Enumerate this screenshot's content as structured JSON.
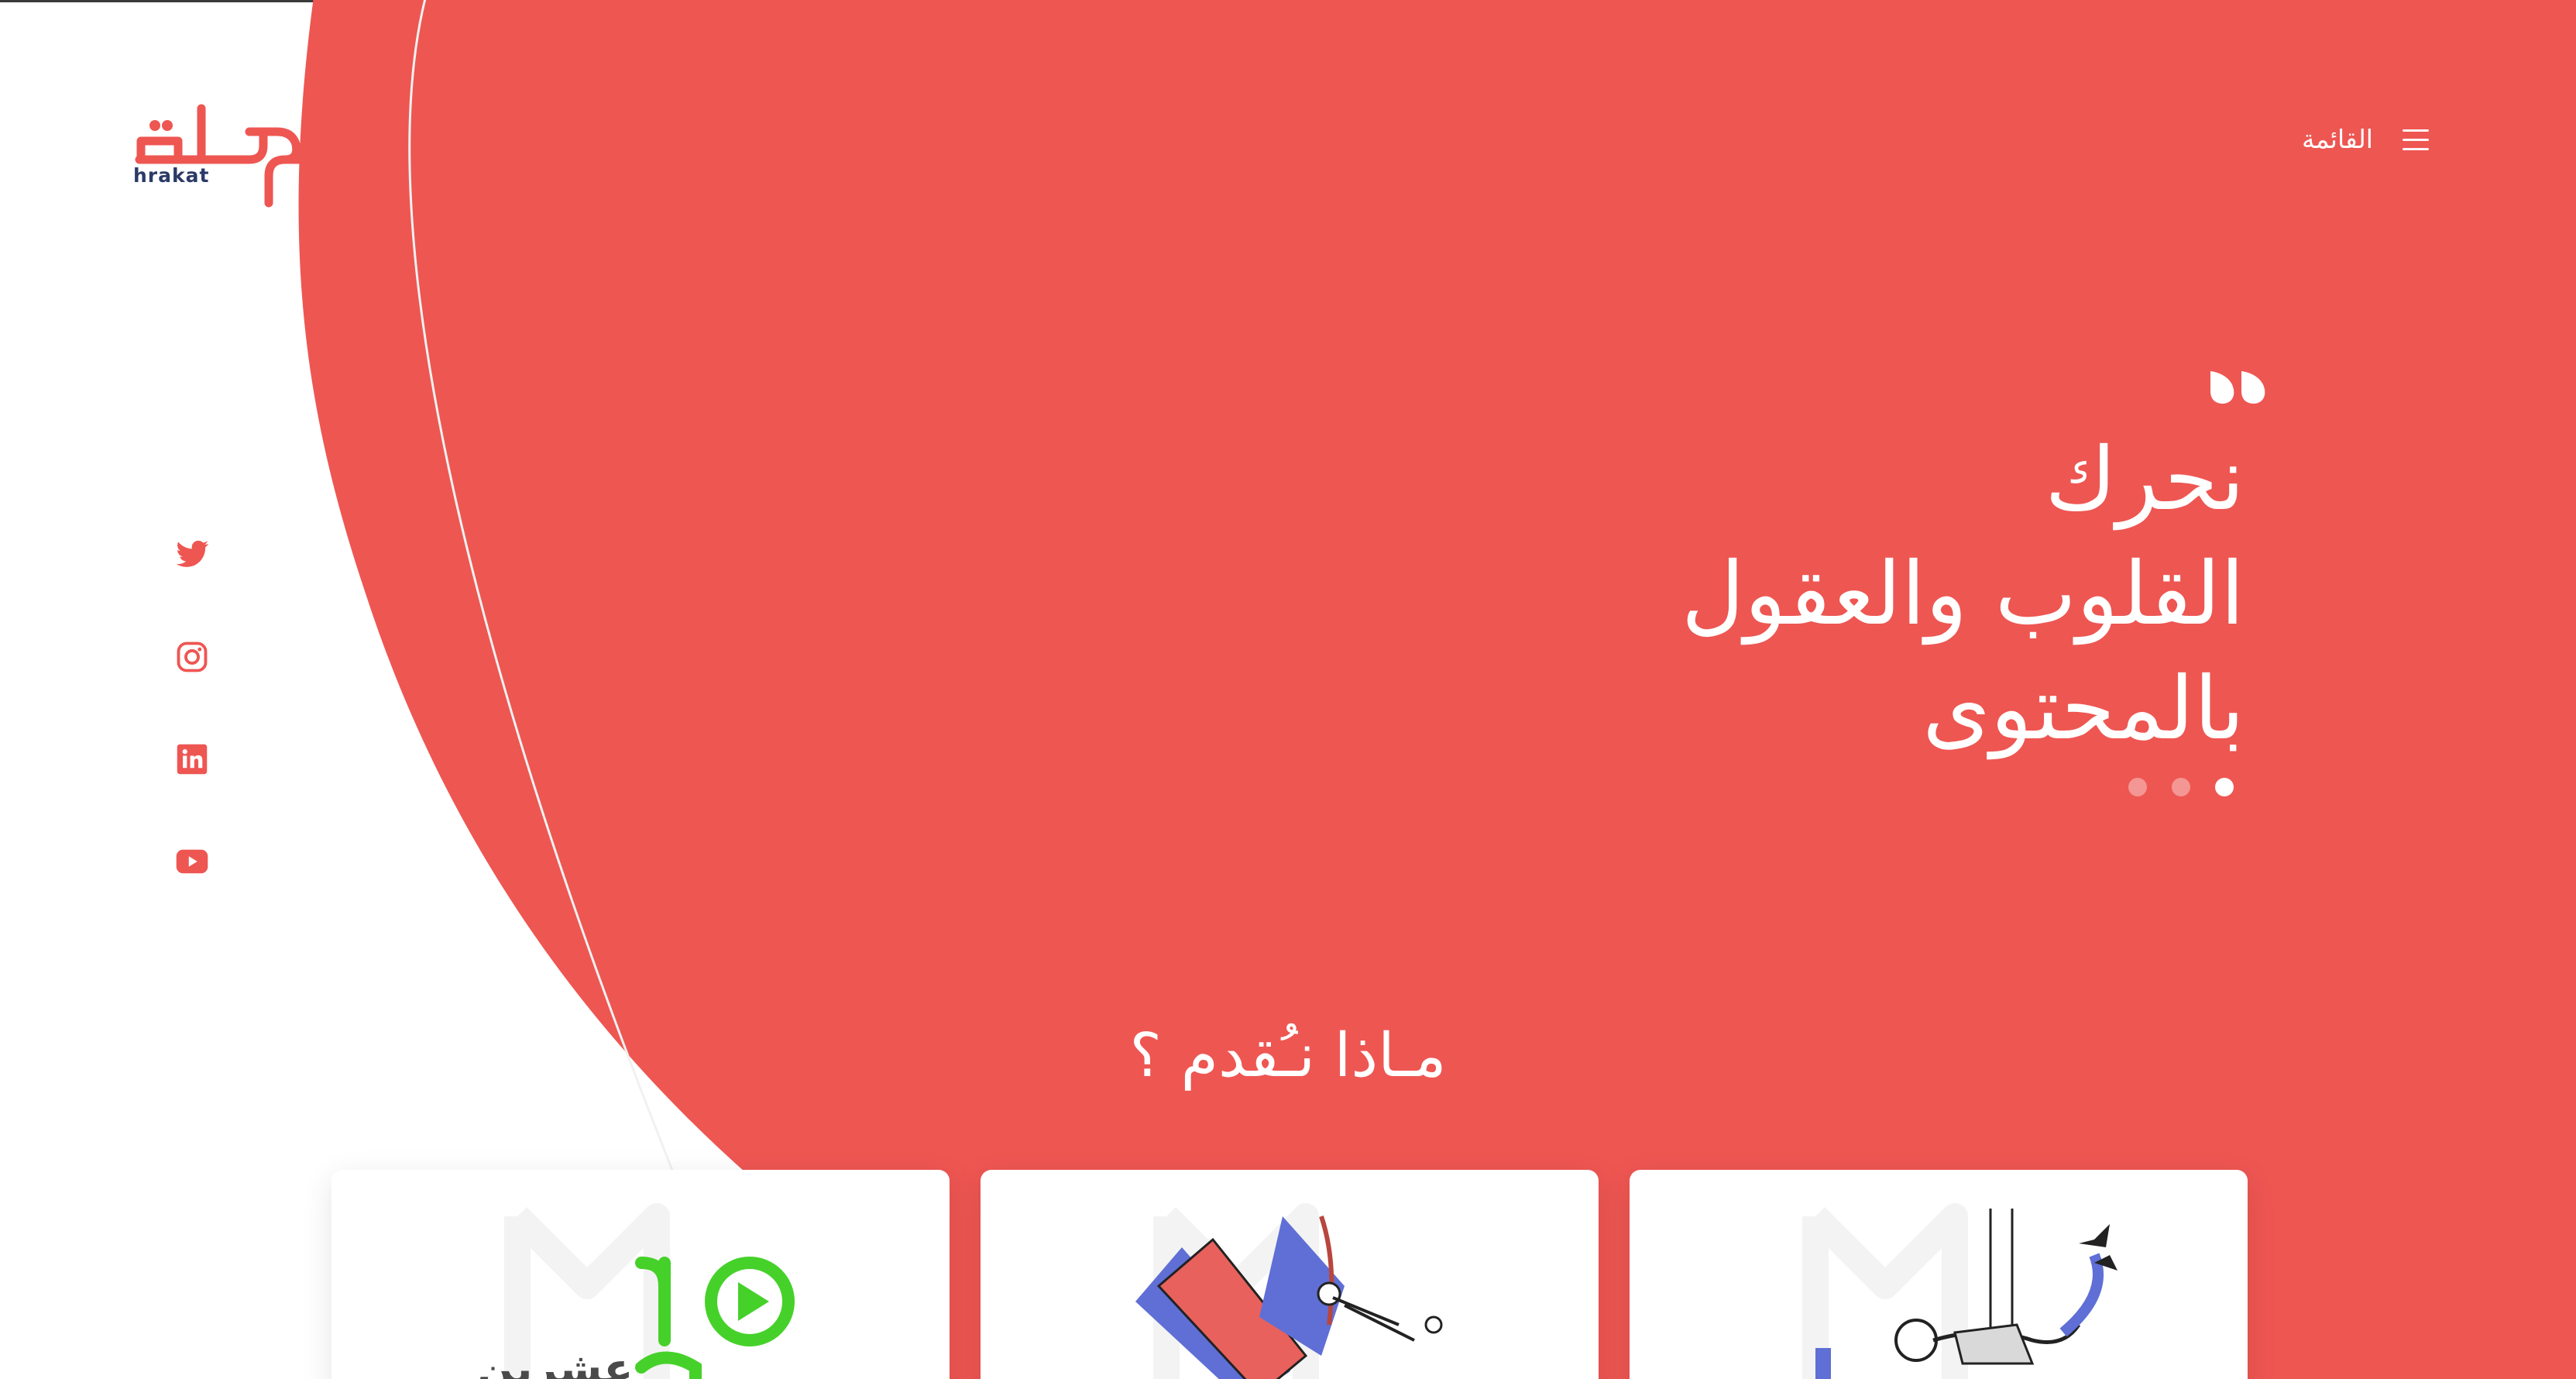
{
  "brand": {
    "latin_name": "hrakat",
    "primary_color": "#EE5652",
    "secondary_color": "#2B3A67"
  },
  "nav": {
    "menu_label": "القائمة",
    "menu_icon": "hamburger-icon"
  },
  "socials": [
    {
      "name": "twitter",
      "icon": "twitter-icon"
    },
    {
      "name": "instagram",
      "icon": "instagram-icon"
    },
    {
      "name": "linkedin",
      "icon": "linkedin-icon"
    },
    {
      "name": "youtube",
      "icon": "youtube-icon"
    }
  ],
  "hero": {
    "quote_icon": "quote-icon",
    "lines": [
      "نحرك",
      "القلوب والعقول",
      "بالمحتوى"
    ],
    "slides_total": 3,
    "active_slide": 3
  },
  "services": {
    "title": "مـاذا نـُقدم ؟",
    "cards": [
      {
        "illustration": "logo-2020-illustration",
        "label": "عشرين"
      },
      {
        "illustration": "flying-book-illustration"
      },
      {
        "illustration": "skydiver-illustration"
      }
    ]
  }
}
